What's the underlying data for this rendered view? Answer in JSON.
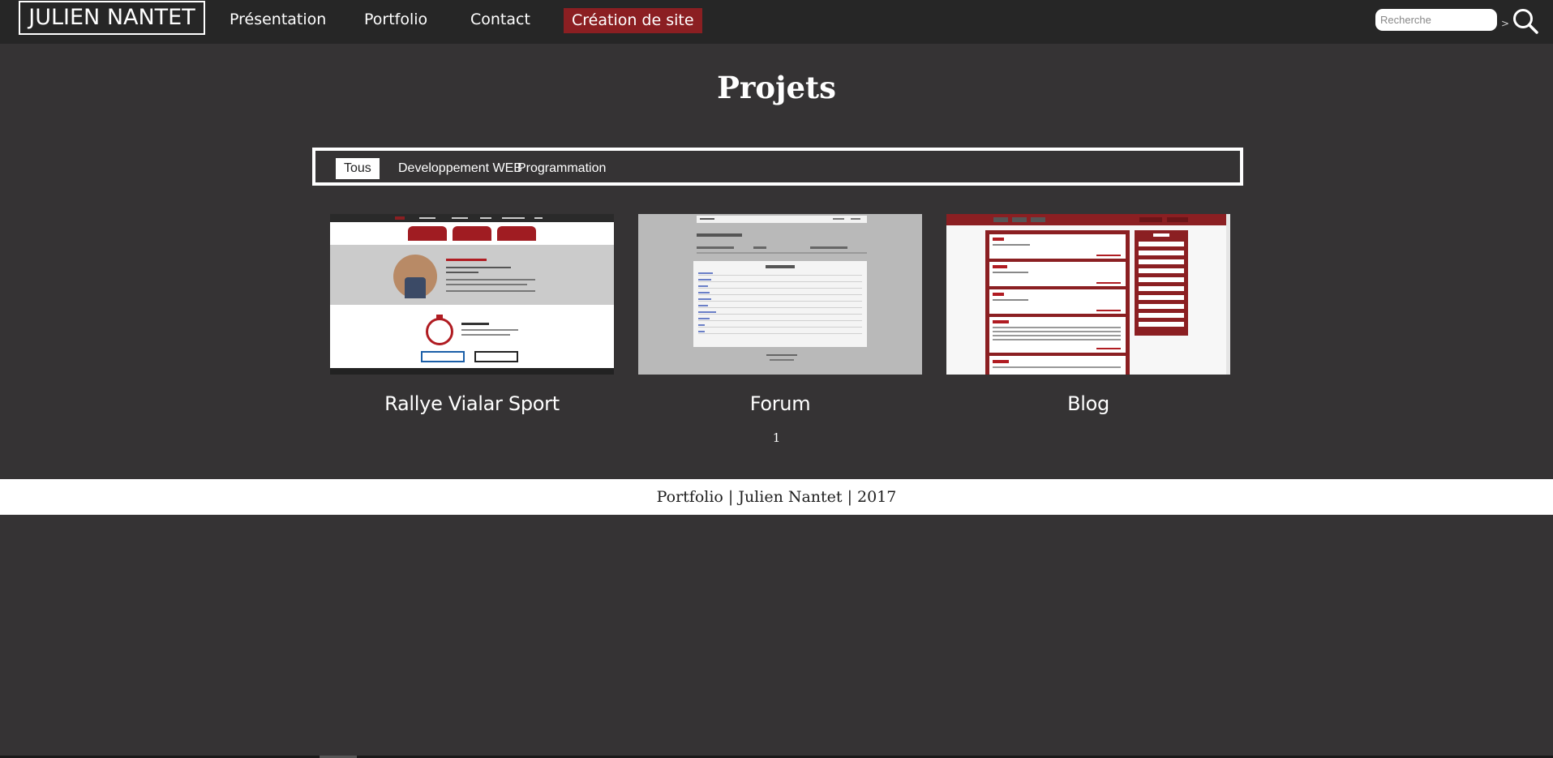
{
  "header": {
    "logo": "JULIEN NANTET",
    "nav": [
      {
        "label": "Présentation"
      },
      {
        "label": "Portfolio"
      },
      {
        "label": "Contact"
      },
      {
        "label": "Création de site",
        "active": true
      }
    ],
    "search": {
      "placeholder": "Recherche",
      "value": "",
      "arrow": ">",
      "icon": "search-icon"
    }
  },
  "main": {
    "title": "Projets",
    "filters": [
      {
        "label": "Tous",
        "active": true
      },
      {
        "label": "Developpement WEB",
        "active": false
      },
      {
        "label": "Programmation",
        "active": false
      }
    ],
    "projects": [
      {
        "title": "Rallye Vialar Sport"
      },
      {
        "title": "Forum"
      },
      {
        "title": "Blog"
      }
    ],
    "pagination": "1"
  },
  "footer": {
    "text": "Portfolio | Julien Nantet | 2017"
  },
  "colors": {
    "background": "#353334",
    "topbar": "#262626",
    "accent": "#8b1f22",
    "footer": "#ffffff"
  }
}
